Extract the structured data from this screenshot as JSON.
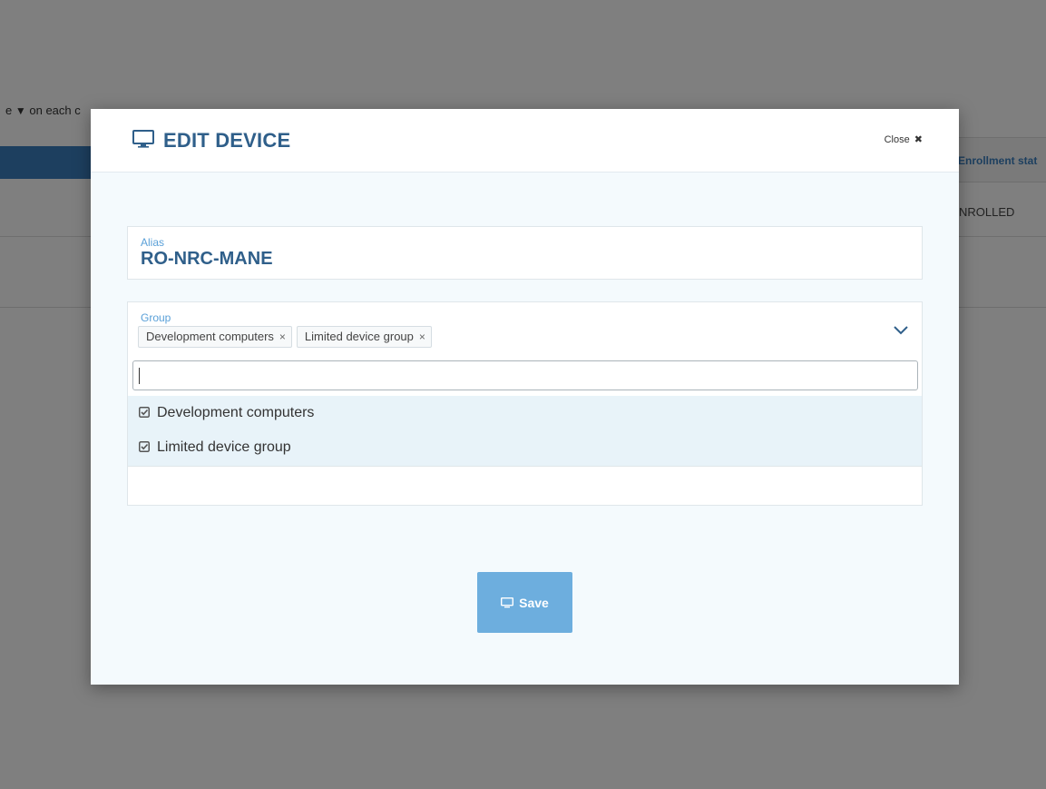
{
  "background": {
    "hint_prefix": "e",
    "hint_suffix": "on each c",
    "enrollment_column": "Enrollment stat",
    "enrollment_value": "NROLLED"
  },
  "modal": {
    "title": "EDIT DEVICE",
    "close_label": "Close",
    "alias": {
      "label": "Alias",
      "value": "RO-NRC-MANE"
    },
    "group": {
      "label": "Group",
      "selected_tags": [
        "Development computers",
        "Limited device group"
      ],
      "search_value": "",
      "options": [
        {
          "label": "Development computers",
          "checked": true
        },
        {
          "label": "Limited device group",
          "checked": true
        }
      ]
    },
    "save_label": "Save"
  },
  "colors": {
    "accent": "#2f5f8a",
    "label": "#5aa0d8",
    "save_button": "#6daede",
    "option_highlight": "#e8f3f9"
  }
}
